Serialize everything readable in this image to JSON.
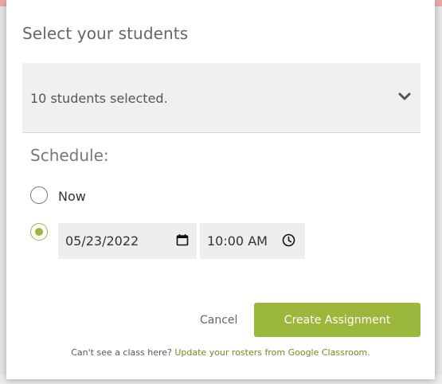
{
  "colors": {
    "accent": "#9cb83c",
    "link": "#6f8a1f"
  },
  "modal": {
    "title": "Select your students",
    "students_dropdown": {
      "selected_text": "10 students selected."
    },
    "schedule": {
      "label": "Schedule:",
      "options": [
        {
          "label": "Now",
          "checked": false
        },
        {
          "label": "",
          "checked": true
        }
      ],
      "date_value": "05/23/2022",
      "time_value": "10:00 AM"
    },
    "actions": {
      "cancel_label": "Cancel",
      "create_label": "Create Assignment"
    },
    "footer": {
      "prefix": "Can't see a class here?",
      "link_text": "Update your rosters from Google Classroom."
    }
  },
  "icons": {
    "dropdown": "chevron-down-icon",
    "date": "calendar-icon",
    "time": "clock-icon"
  }
}
